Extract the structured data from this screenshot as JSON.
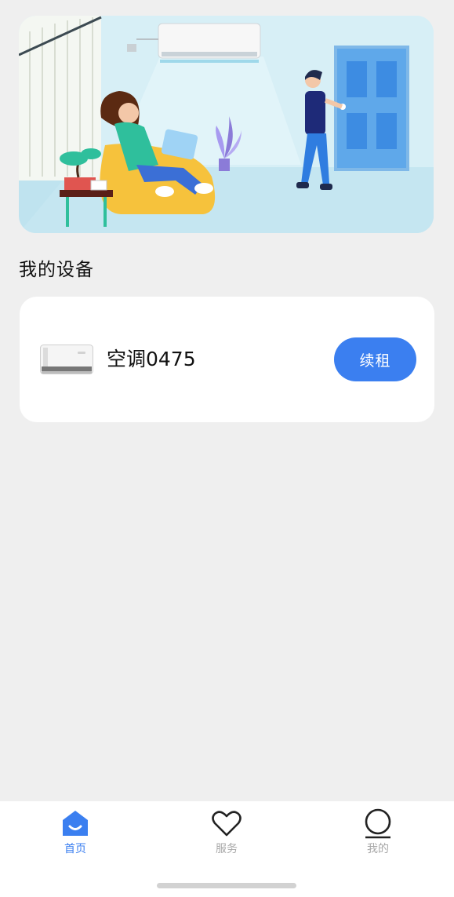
{
  "banner": {
    "illustration": "living-room-air-conditioner-illustration"
  },
  "section": {
    "title": "我的设备"
  },
  "device": {
    "icon": "air-conditioner-icon",
    "name": "空调0475",
    "action_label": "续租"
  },
  "tabbar": {
    "items": [
      {
        "label": "首页",
        "icon": "home-icon",
        "active": true
      },
      {
        "label": "服务",
        "icon": "heart-icon",
        "active": false
      },
      {
        "label": "我的",
        "icon": "profile-icon",
        "active": false
      }
    ]
  },
  "colors": {
    "accent": "#3b7ff0",
    "background": "#efefef",
    "card": "#ffffff",
    "inactive_tab": "#a8a8a8"
  }
}
